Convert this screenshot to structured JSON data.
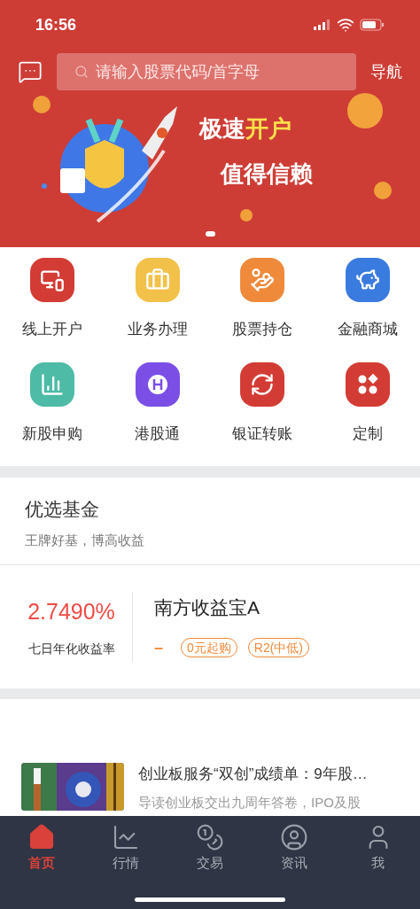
{
  "status_bar": {
    "time": "16:56"
  },
  "header": {
    "search_placeholder": "请输入股票代码/首字母",
    "nav_label": "导航"
  },
  "banner": {
    "headline_lead": "极速",
    "headline_highlight": "开户",
    "tagline": "值得信赖",
    "pages": [
      {
        "selected": true
      }
    ]
  },
  "shortcuts": [
    {
      "kind": "account",
      "label": "线上开户",
      "color": "#d33c35"
    },
    {
      "kind": "briefcase",
      "label": "业务办理",
      "color": "#f2c14a"
    },
    {
      "kind": "moneybag",
      "label": "股票持仓",
      "color": "#ef8a3a"
    },
    {
      "kind": "piggy",
      "label": "金融商城",
      "color": "#3a7be0"
    },
    {
      "kind": "chart",
      "label": "新股申购",
      "color": "#4dbba6"
    },
    {
      "kind": "hk",
      "label": "港股通",
      "color": "#7b4fe6"
    },
    {
      "kind": "transfer",
      "label": "银证转账",
      "color": "#d33c35"
    },
    {
      "kind": "custom",
      "label": "定制",
      "color": "#d33c35"
    }
  ],
  "fund_section": {
    "title": "优选基金",
    "subtitle": "王牌好基，博高收益",
    "fund": {
      "rate": "2.7490%",
      "rate_label": "七日年化收益率",
      "name": "南方收益宝A",
      "change": "–",
      "tags": [
        "0元起购",
        "R2(中低)"
      ]
    }
  },
  "news": [
    {
      "title": "创业板服务“双创”成绩单：9年股…",
      "summary": "导读创业板交出九周年答卷，IPO及股"
    }
  ],
  "tab_bar": [
    {
      "kind": "home",
      "label": "首页",
      "selected": true
    },
    {
      "kind": "market",
      "label": "行情",
      "selected": false
    },
    {
      "kind": "trade",
      "label": "交易",
      "selected": false
    },
    {
      "kind": "news",
      "label": "资讯",
      "selected": false
    },
    {
      "kind": "me",
      "label": "我",
      "selected": false
    }
  ]
}
